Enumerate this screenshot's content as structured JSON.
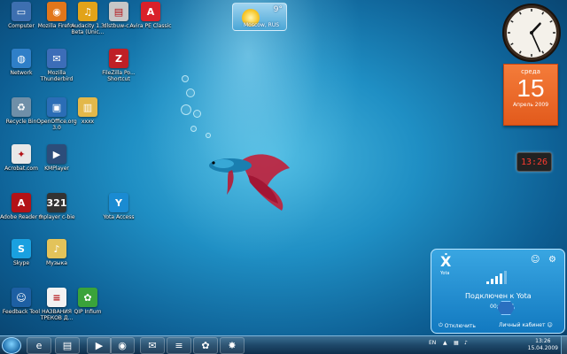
{
  "desktop": {
    "icons": [
      {
        "label": "Computer",
        "icon": "computer-icon",
        "color": "#3d6fb0",
        "glyph": "▭"
      },
      {
        "label": "Mozilla Firefox",
        "icon": "firefox-icon",
        "color": "#e2761b",
        "glyph": "◉"
      },
      {
        "label": "Audacity 1.3 Beta (Unic...",
        "icon": "audacity-icon",
        "color": "#e2a319",
        "glyph": "♫"
      },
      {
        "label": "dlstbuw-c...",
        "icon": "folder-icon",
        "color": "#c7c7c7",
        "glyph": "▤"
      },
      {
        "label": "Avira PE Classic",
        "icon": "avira-icon",
        "color": "#d9212a",
        "glyph": "A"
      },
      {
        "label": "Network",
        "icon": "network-icon",
        "color": "#2f7fc8",
        "glyph": "◍"
      },
      {
        "label": "Mozilla Thunderbird",
        "icon": "thunderbird-icon",
        "color": "#3c6db8",
        "glyph": "✉"
      },
      {
        "label": "FileZilla Po... Shortcut",
        "icon": "filezilla-icon",
        "color": "#bf2026",
        "glyph": "Z"
      },
      {
        "label": "Recycle Bin",
        "icon": "recycle-bin-icon",
        "color": "#6f8fa8",
        "glyph": "♻"
      },
      {
        "label": "OpenOffice.org 3.0",
        "icon": "openoffice-icon",
        "color": "#2a6db6",
        "glyph": "▣"
      },
      {
        "label": "xxxx",
        "icon": "zip-folder-icon",
        "color": "#e3b84a",
        "glyph": "▥"
      },
      {
        "label": "Acrobat.com",
        "icon": "acrobat-com-icon",
        "color": "#e8e8e8",
        "glyph": "✦"
      },
      {
        "label": "KMPlayer",
        "icon": "kmplayer-icon",
        "color": "#2c4d7a",
        "glyph": "▶"
      },
      {
        "label": "Adobe Reader 9",
        "icon": "adobe-reader-icon",
        "color": "#b31217",
        "glyph": "A"
      },
      {
        "label": "mplayer c-bie",
        "icon": "mplayer-icon",
        "color": "#333333",
        "glyph": "321"
      },
      {
        "label": "Yota Access",
        "icon": "yota-access-icon",
        "color": "#1a8bd2",
        "glyph": "Y"
      },
      {
        "label": "Skype",
        "icon": "skype-icon",
        "color": "#1aa0e0",
        "glyph": "S"
      },
      {
        "label": "Музыка",
        "icon": "music-folder-icon",
        "color": "#e3c35a",
        "glyph": "♪"
      },
      {
        "label": "Feedback Tool",
        "icon": "feedback-tool-icon",
        "color": "#1d5fa3",
        "glyph": "☺"
      },
      {
        "label": "НАЗВАНИЯ ТРЕКОВ Д...",
        "icon": "text-file-icon",
        "color": "#f2f2f2",
        "glyph": "≡"
      },
      {
        "label": "QIP Infium",
        "icon": "qip-icon",
        "color": "#3aa33a",
        "glyph": "✿"
      }
    ]
  },
  "weather": {
    "city": "Moscow, RUS",
    "temp": "9°"
  },
  "clock": {
    "hour": 1,
    "minute": 26
  },
  "calendar": {
    "day_of_week": "среда",
    "day": "15",
    "month_year": "Апрель 2009"
  },
  "digital_clock": {
    "time": "13:26"
  },
  "yota": {
    "brand": "Yota",
    "status": "Подключен к Yota",
    "timer": "00:02:07",
    "disconnect": "Отключить",
    "cabinet": "Личный кабинет",
    "signal_level": 4
  },
  "taskbar": {
    "items": [
      {
        "icon": "internet-explorer-icon",
        "glyph": "e"
      },
      {
        "icon": "explorer-icon",
        "glyph": "▤"
      },
      {
        "icon": "media-player-icon",
        "glyph": "▶"
      },
      {
        "icon": "firefox-icon",
        "glyph": "◉"
      },
      {
        "icon": "thunderbird-icon",
        "glyph": "✉"
      },
      {
        "icon": "notepad-icon",
        "glyph": "≡"
      },
      {
        "icon": "qip-icon",
        "glyph": "✿"
      },
      {
        "icon": "game-icon",
        "glyph": "✸"
      }
    ],
    "language": "EN",
    "time": "13:26",
    "date": "15.04.2009"
  },
  "colors": {
    "yota_blue": "#1a8bd2",
    "calendar_orange": "#e85f1f",
    "digital_red": "#ff3b2f"
  }
}
